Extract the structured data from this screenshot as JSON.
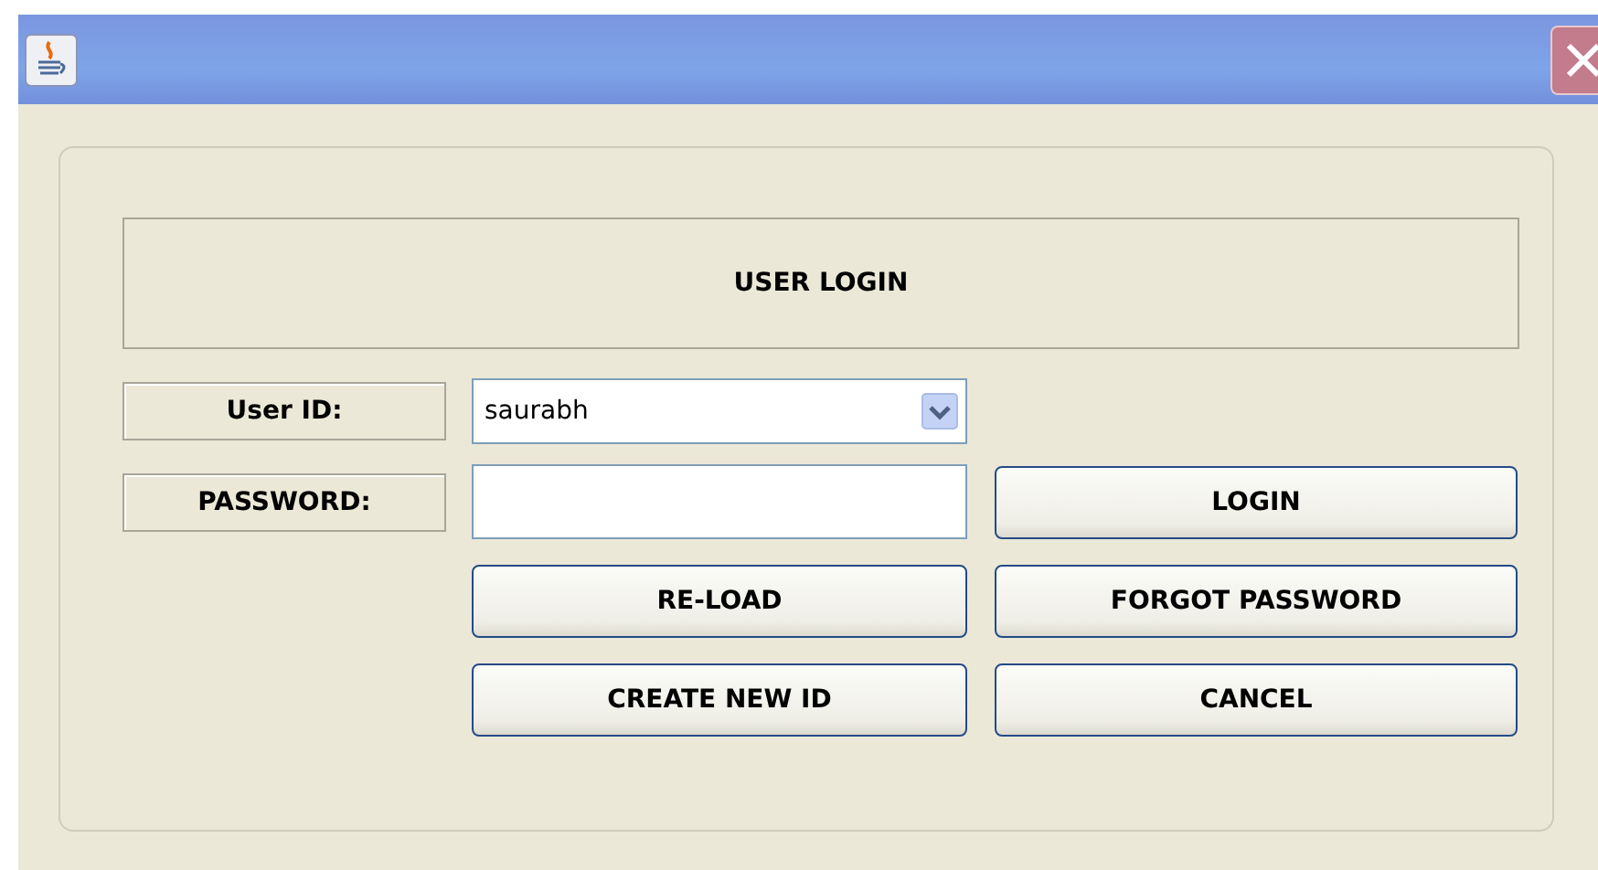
{
  "heading": "USER LOGIN",
  "fields": [
    {
      "kind": "combo",
      "label": "User ID:",
      "value": "saurabh"
    },
    {
      "kind": "text",
      "label": "PASSWORD:"
    }
  ],
  "buttons": [
    "LOGIN",
    "RE-LOAD",
    "FORGOT PASSWORD",
    "CREATE NEW ID",
    "CANCEL"
  ]
}
